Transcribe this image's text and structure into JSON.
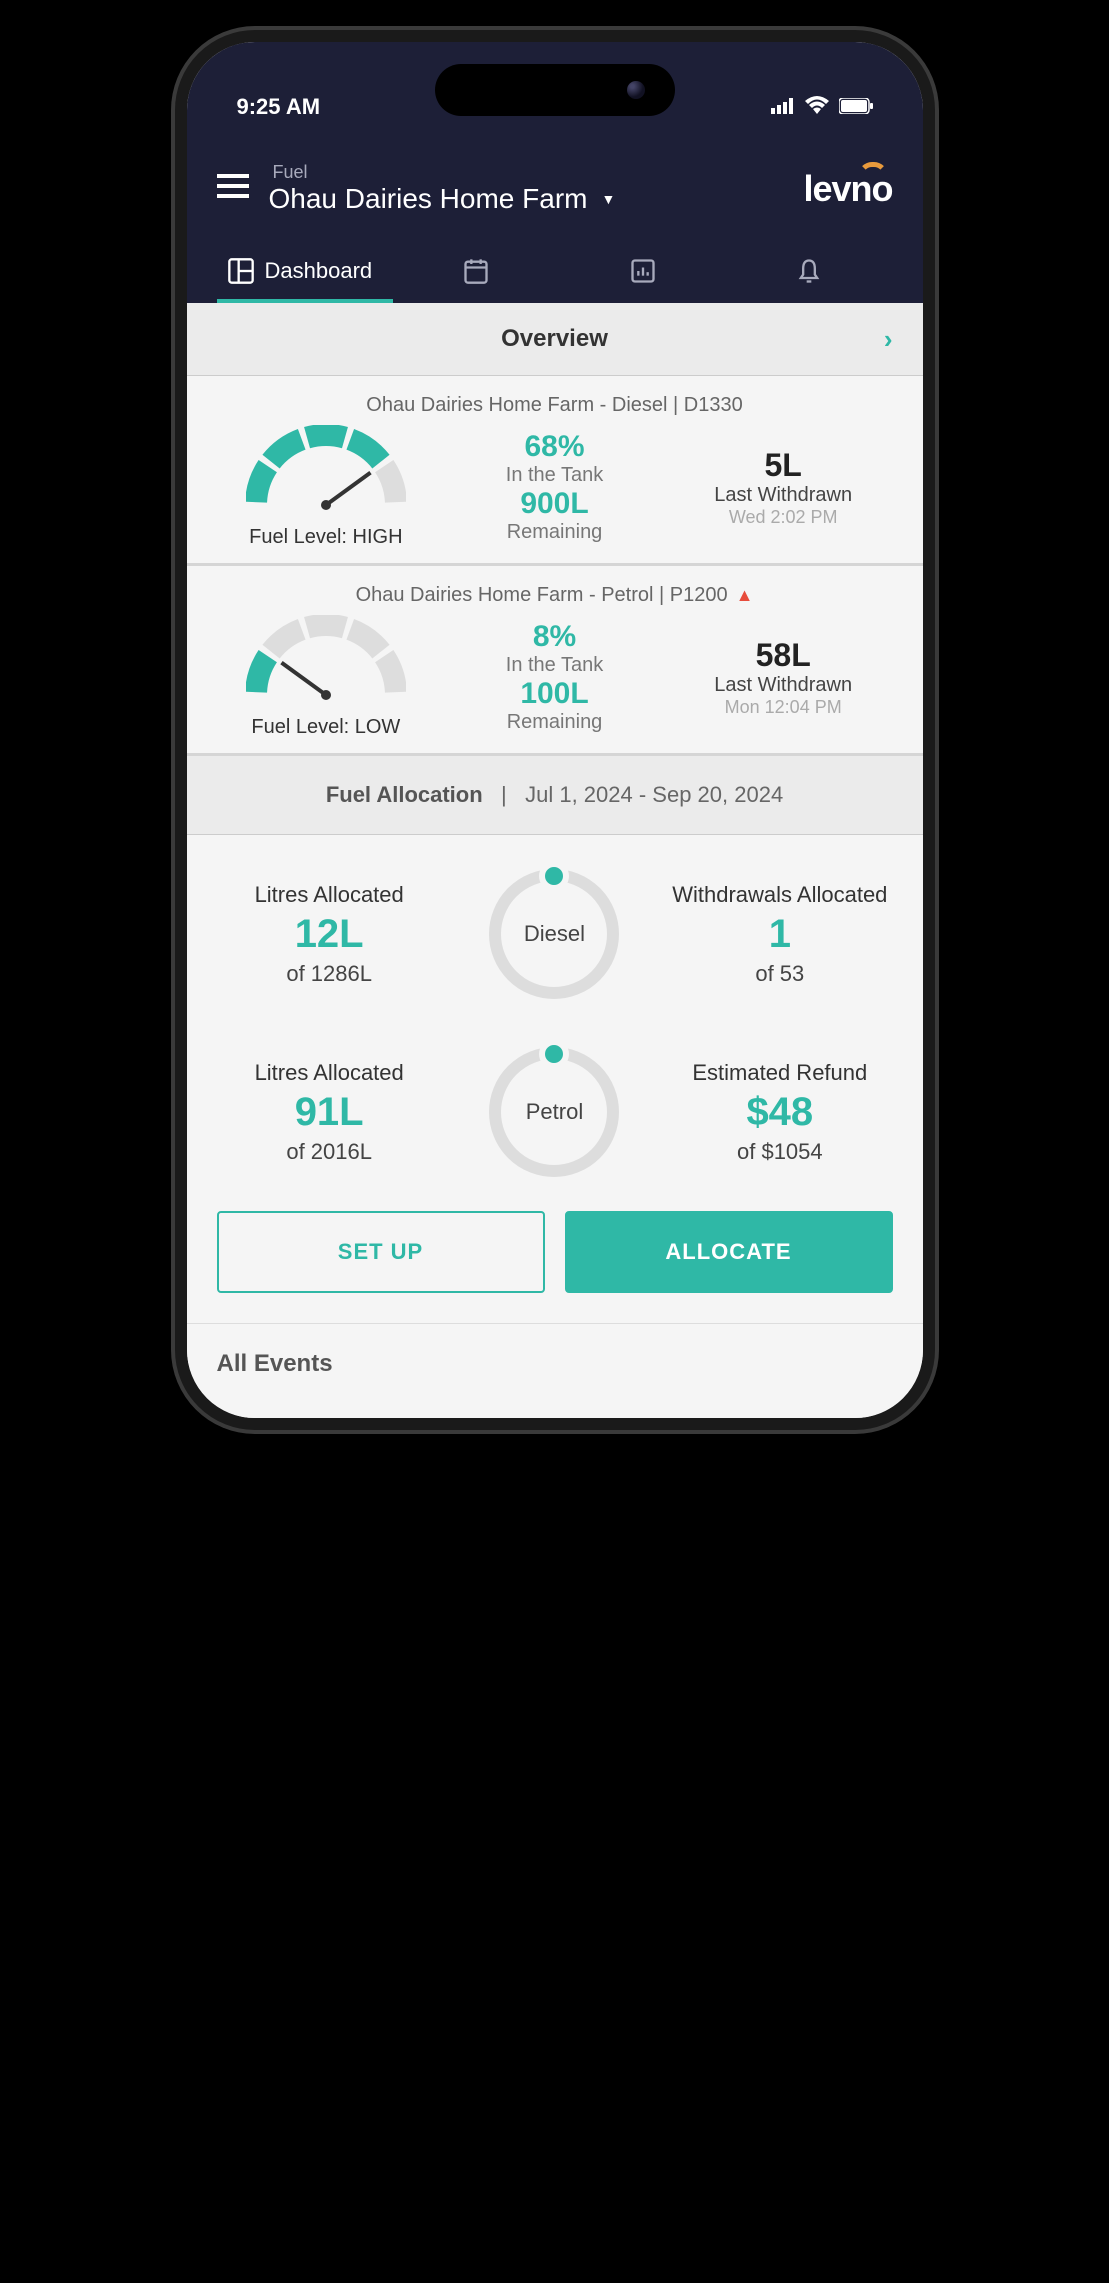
{
  "status": {
    "time": "9:25 AM"
  },
  "header": {
    "category": "Fuel",
    "location": "Ohau Dairies Home Farm",
    "logo_text": "levno"
  },
  "tabs": {
    "dashboard": "Dashboard"
  },
  "overview": {
    "title": "Overview"
  },
  "tanks": [
    {
      "title": "Ohau Dairies Home Farm - Diesel | D1330",
      "alert": false,
      "level_label": "Fuel Level: HIGH",
      "percent": "68%",
      "percent_sub": "In the Tank",
      "remaining": "900L",
      "remaining_sub": "Remaining",
      "last_val": "5L",
      "last_label": "Last Withdrawn",
      "last_time": "Wed 2:02 PM",
      "gauge_fill": 4
    },
    {
      "title": "Ohau Dairies Home Farm - Petrol | P1200",
      "alert": true,
      "level_label": "Fuel Level: LOW",
      "percent": "8%",
      "percent_sub": "In the Tank",
      "remaining": "100L",
      "remaining_sub": "Remaining",
      "last_val": "58L",
      "last_label": "Last Withdrawn",
      "last_time": "Mon 12:04 PM",
      "gauge_fill": 1
    }
  ],
  "allocation": {
    "header_label": "Fuel Allocation",
    "header_range": "Jul 1, 2024 - Sep 20, 2024",
    "rows": [
      {
        "left_title": "Litres Allocated",
        "left_val": "12L",
        "left_sub": "of 1286L",
        "ring": "Diesel",
        "right_title": "Withdrawals Allocated",
        "right_val": "1",
        "right_sub": "of 53"
      },
      {
        "left_title": "Litres Allocated",
        "left_val": "91L",
        "left_sub": "of 2016L",
        "ring": "Petrol",
        "right_title": "Estimated Refund",
        "right_val": "$48",
        "right_sub": "of $1054"
      }
    ],
    "btn_setup": "SET UP",
    "btn_allocate": "ALLOCATE"
  },
  "footer": {
    "title": "All Events"
  },
  "chart_data": [
    {
      "type": "bar",
      "title": "Diesel tank gauge",
      "categories": [
        "percent_full"
      ],
      "values": [
        68
      ],
      "ylim": [
        0,
        100
      ]
    },
    {
      "type": "bar",
      "title": "Petrol tank gauge",
      "categories": [
        "percent_full"
      ],
      "values": [
        8
      ],
      "ylim": [
        0,
        100
      ]
    }
  ]
}
